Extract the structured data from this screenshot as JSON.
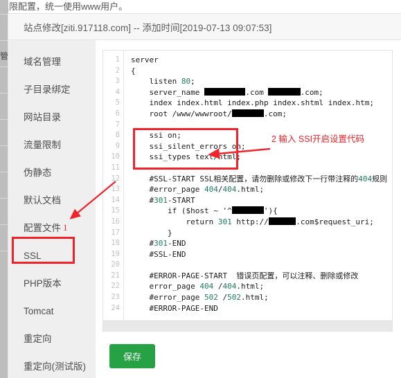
{
  "background": {
    "top_text": "权限配置，统一使用www用户。",
    "left_label": "管"
  },
  "modal": {
    "title": "站点修改[ziti.917118.com] -- 添加时间[2019-07-13 09:07:53]"
  },
  "sidebar": {
    "items": [
      {
        "label": "域名管理"
      },
      {
        "label": "子目录绑定"
      },
      {
        "label": "网站目录"
      },
      {
        "label": "流量限制"
      },
      {
        "label": "伪静态"
      },
      {
        "label": "默认文档"
      },
      {
        "label": "配置文件"
      },
      {
        "label": "SSL"
      },
      {
        "label": "PHP版本"
      },
      {
        "label": "Tomcat"
      },
      {
        "label": "重定向"
      },
      {
        "label": "重定向(测试版)"
      }
    ],
    "active_index": 6
  },
  "annotations": {
    "step1_number": "1",
    "step2_text": "2 输入 SSI开启设置代码",
    "accent_color": "#f1232a"
  },
  "editor": {
    "line_numbers": [
      "1",
      "2",
      "3",
      "4",
      "5",
      "6",
      "7",
      "8",
      "9",
      "10",
      "11",
      "12",
      "13",
      "14",
      "15",
      "16",
      "17",
      "18",
      "19",
      "20",
      "21",
      "22",
      "23",
      "24"
    ],
    "lines": [
      {
        "n": 1,
        "text": "server"
      },
      {
        "n": 2,
        "text": "{"
      },
      {
        "n": 3,
        "text": "    listen 80;"
      },
      {
        "n": 4,
        "text": "    server_name █████████.com ███████.com;"
      },
      {
        "n": 5,
        "text": "    index index.html index.php index.shtml index.htm;"
      },
      {
        "n": 6,
        "text": "    root /www/wwwroot/███████.com;"
      },
      {
        "n": 7,
        "text": ""
      },
      {
        "n": 8,
        "text": "    ssi on;"
      },
      {
        "n": 9,
        "text": "    ssi_silent_errors on;"
      },
      {
        "n": 10,
        "text": "    ssi_types text/html;"
      },
      {
        "n": 11,
        "text": ""
      },
      {
        "n": 12,
        "text": "    #SSL-START SSL相关配置，请勿删除或修改下一行带注释的404规则"
      },
      {
        "n": 13,
        "text": "    #error_page 404/404.html;"
      },
      {
        "n": 14,
        "text": "    #301-START"
      },
      {
        "n": 15,
        "text": "        if ($host ~ '^███████'){"
      },
      {
        "n": 16,
        "text": "            return 301 http://██████.com$request_uri;"
      },
      {
        "n": 17,
        "text": "        }"
      },
      {
        "n": 18,
        "text": "    #301-END"
      },
      {
        "n": 19,
        "text": "    #SSL-END"
      },
      {
        "n": 20,
        "text": ""
      },
      {
        "n": 21,
        "text": "    #ERROR-PAGE-START  错误页配置，可以注释、删除或修改"
      },
      {
        "n": 22,
        "text": "    error_page 404 /404.html;"
      },
      {
        "n": 23,
        "text": "    #error_page 502 /502.html;"
      },
      {
        "n": 24,
        "text": "    #ERROR-PAGE-END"
      }
    ],
    "highlighted_numbers": [
      "80",
      "404",
      "301",
      "502"
    ]
  },
  "footer": {
    "save_label": "保存"
  }
}
